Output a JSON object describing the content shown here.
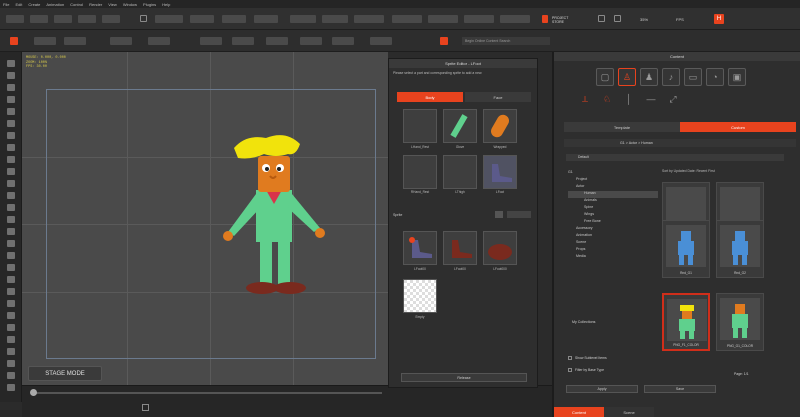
{
  "menu": [
    "File",
    "Edit",
    "Create",
    "Animation",
    "Control",
    "Render",
    "View",
    "Window",
    "Plugins",
    "Help"
  ],
  "toolbar": {
    "project_label": "PROJECT STORE",
    "val1": "35%",
    "val2": "FPS",
    "search_placeholder": "Begin Online Content Search"
  },
  "stage": {
    "info_lines": [
      "MOUSE: 0.000, 0.000",
      "ZOOM: 100%",
      "FPS: 30.00"
    ],
    "mode_label": "STAGE MODE"
  },
  "sprite_editor": {
    "title": "Sprite Editor - LFoot",
    "hint": "Please select a part and corresponding sprite to add a new.",
    "tabs": [
      "Body",
      "Face"
    ],
    "parts": [
      {
        "name": "LHand_Rest"
      },
      {
        "name": "Glove"
      },
      {
        "name": "Wrapped"
      },
      {
        "name": "RHand_Rest"
      },
      {
        "name": "LThigh"
      },
      {
        "name": "LFoot"
      }
    ],
    "sprites_label": "Sprite",
    "sprites": [
      {
        "name": "LFoot00"
      },
      {
        "name": "LFoot00"
      },
      {
        "name": "LFoot000"
      },
      {
        "name": "Empty"
      }
    ],
    "button": "Release"
  },
  "content": {
    "title": "Content",
    "tabs": [
      "Template",
      "Custom"
    ],
    "breadcrumb": "G1 > Actor > Human",
    "filter_label": "Default",
    "sort_label": "Sort by Updated Date: Recent First",
    "tree": [
      {
        "label": "G1",
        "indent": 0
      },
      {
        "label": "Project",
        "indent": 1
      },
      {
        "label": "Actor",
        "indent": 1
      },
      {
        "label": "Human",
        "indent": 2
      },
      {
        "label": "Animals",
        "indent": 2
      },
      {
        "label": "Spine",
        "indent": 2
      },
      {
        "label": "Wings",
        "indent": 2
      },
      {
        "label": "Free Bone",
        "indent": 2
      },
      {
        "label": "Accessory",
        "indent": 1
      },
      {
        "label": "Animation",
        "indent": 1
      },
      {
        "label": "Scene",
        "indent": 1
      },
      {
        "label": "Props",
        "indent": 1
      },
      {
        "label": "Media",
        "indent": 1
      }
    ],
    "my_collections": "My Collections",
    "cards": [
      {
        "label": "PNG_G2_5.8_C..."
      },
      {
        "label": "PNG_G1_COLOR"
      },
      {
        "label": "Rnd_G1"
      },
      {
        "label": "Rnd_G2"
      },
      {
        "label": "PNG_F1_COLOR"
      },
      {
        "label": "PNG_G1_COLOR"
      }
    ],
    "show_sublevel": "Show Sublevel Items",
    "filter_base": "Filter by Base Type",
    "page": "Page: 1/1",
    "apply": "Apply",
    "save": "Save",
    "bottom_tabs": [
      "Content",
      "Scene"
    ]
  },
  "colors": {
    "accent": "#e8431e",
    "stage": "#4a4a4a",
    "hair": "#f1e30c",
    "suit": "#5fd08d",
    "skin": "#e07b1f",
    "shoes": "#7a2a1e"
  }
}
